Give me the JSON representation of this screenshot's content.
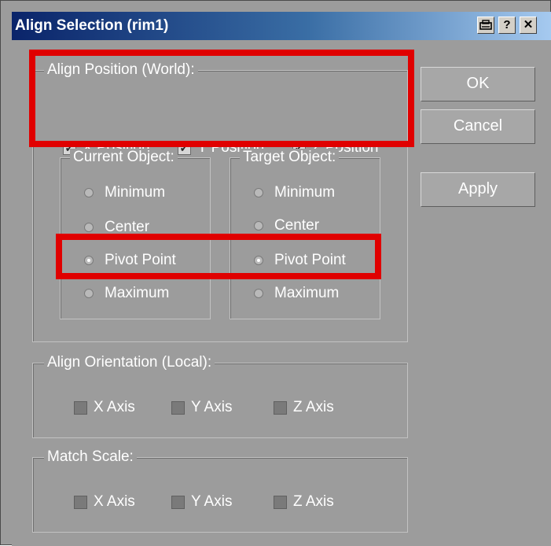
{
  "window": {
    "title": "Align Selection (rim1)",
    "title_buttons": {
      "pin_icon": "pin-icon",
      "help": "?",
      "close": "✕"
    }
  },
  "align_position": {
    "group_label": "Align Position (World):",
    "x": {
      "label": "X Position",
      "checked": true
    },
    "y": {
      "label": "Y Position",
      "checked": true
    },
    "z": {
      "label": "Z Position",
      "checked": true
    }
  },
  "current_object": {
    "group_label": "Current Object:",
    "options": [
      "Minimum",
      "Center",
      "Pivot Point",
      "Maximum"
    ],
    "selected": "Pivot Point"
  },
  "target_object": {
    "group_label": "Target Object:",
    "options": [
      "Minimum",
      "Center",
      "Pivot Point",
      "Maximum"
    ],
    "selected": "Pivot Point"
  },
  "align_orientation": {
    "group_label": "Align Orientation (Local):",
    "x": {
      "label": "X Axis",
      "checked": false
    },
    "y": {
      "label": "Y Axis",
      "checked": false
    },
    "z": {
      "label": "Z Axis",
      "checked": false
    }
  },
  "match_scale": {
    "group_label": "Match Scale:",
    "x": {
      "label": "X Axis",
      "checked": false
    },
    "y": {
      "label": "Y Axis",
      "checked": false
    },
    "z": {
      "label": "Z Axis",
      "checked": false
    }
  },
  "buttons": {
    "ok": "OK",
    "cancel": "Cancel",
    "apply": "Apply"
  },
  "colors": {
    "title_bar_start": "#0a246a",
    "panel": "#9c9c9c",
    "highlight": "#e00000"
  }
}
